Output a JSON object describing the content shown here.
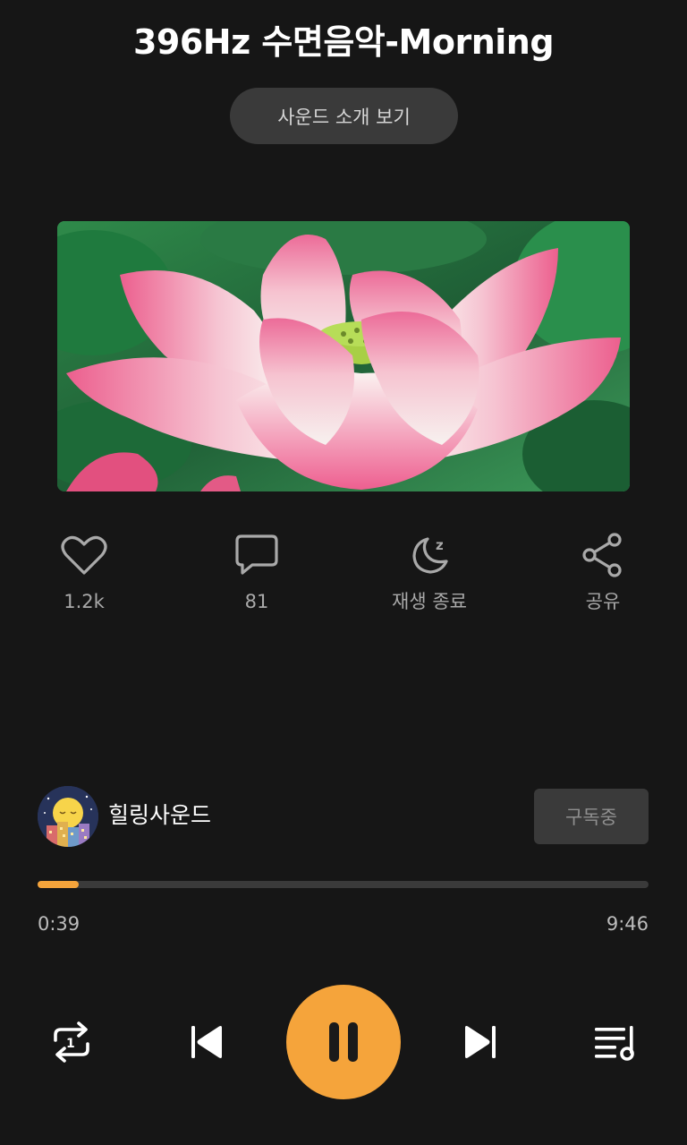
{
  "track": {
    "title": "396Hz 수면음악-Morning",
    "intro_button": "사운드 소개 보기",
    "cover_image": "lotus-flower"
  },
  "actions": [
    {
      "icon": "heart-icon",
      "label": "1.2k"
    },
    {
      "icon": "comment-icon",
      "label": "81"
    },
    {
      "icon": "sleep-timer-icon",
      "label": "재생 종료"
    },
    {
      "icon": "share-icon",
      "label": "공유"
    }
  ],
  "channel": {
    "name": "힐링사운드",
    "subscribe_label": "구독중"
  },
  "player": {
    "current_time": "0:39",
    "total_time": "9:46",
    "progress": 0.067,
    "state": "playing"
  },
  "controls": [
    "repeat-one-icon",
    "previous-icon",
    "pause-icon",
    "next-icon",
    "playlist-icon"
  ],
  "colors": {
    "accent": "#f5a43b",
    "background": "#161616",
    "button_bg": "#3a3a3a"
  }
}
